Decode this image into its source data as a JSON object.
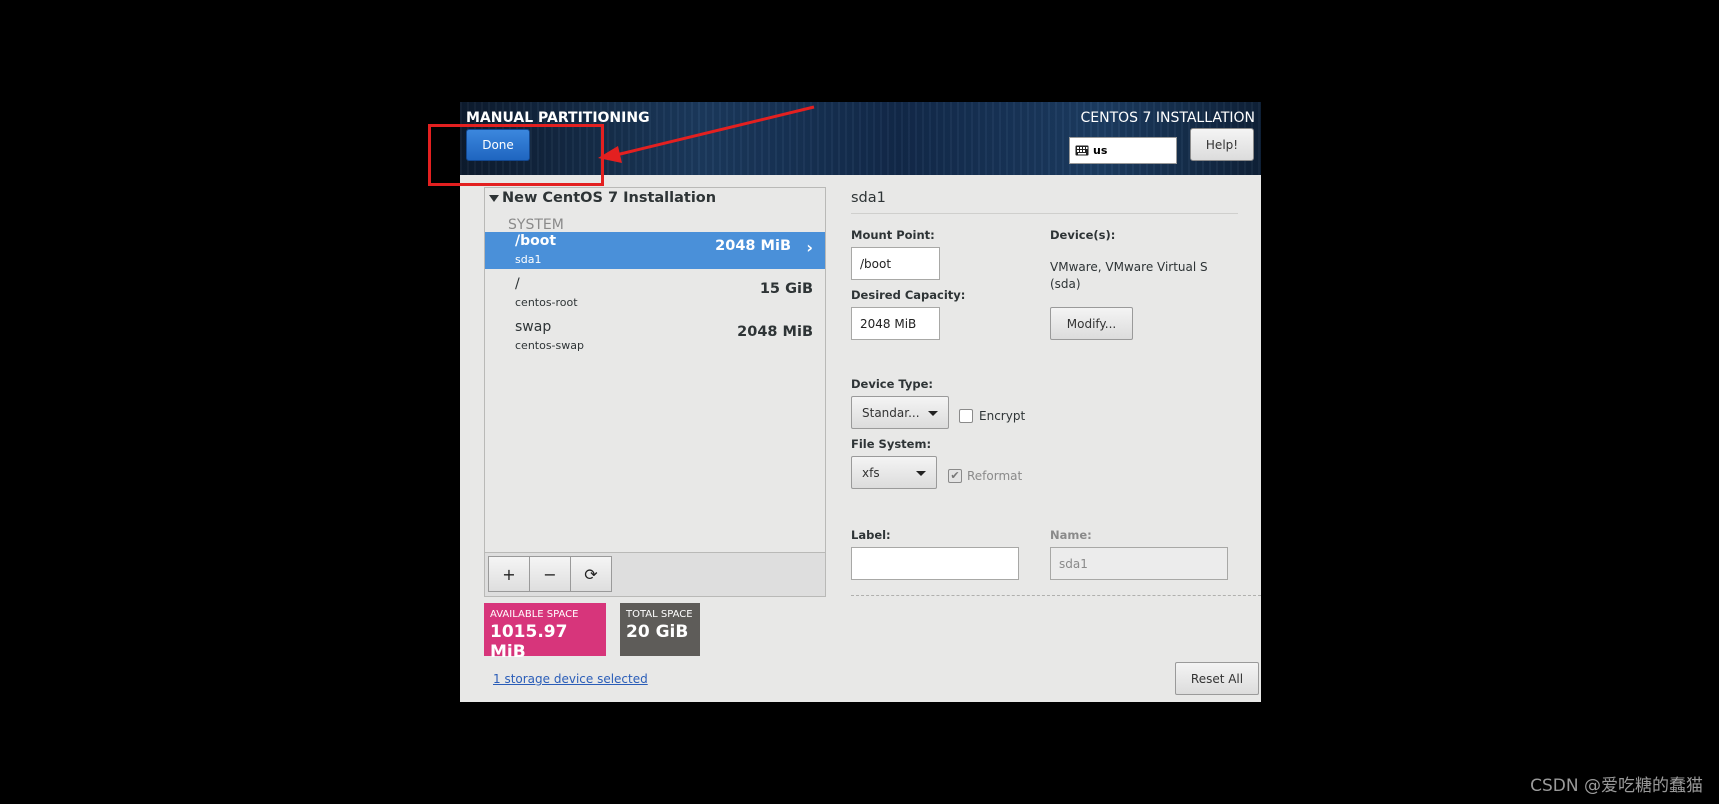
{
  "header": {
    "title": "MANUAL PARTITIONING",
    "product": "CENTOS 7 INSTALLATION",
    "done_label": "Done",
    "keyboard_layout": "us",
    "help_label": "Help!"
  },
  "tree": {
    "group": "New CentOS 7 Installation",
    "section": "SYSTEM",
    "partitions": [
      {
        "mount": "/boot",
        "device": "sda1",
        "size": "2048 MiB",
        "selected": true
      },
      {
        "mount": "/",
        "device": "centos-root",
        "size": "15 GiB",
        "selected": false
      },
      {
        "mount": "swap",
        "device": "centos-swap",
        "size": "2048 MiB",
        "selected": false
      }
    ]
  },
  "toolbar": {
    "add": "+",
    "remove": "−",
    "refresh": "⟳"
  },
  "space": {
    "available_label": "AVAILABLE SPACE",
    "available_value": "1015.97 MiB",
    "total_label": "TOTAL SPACE",
    "total_value": "20 GiB"
  },
  "storage_link": "1 storage device selected",
  "detail": {
    "title": "sda1",
    "mount_point_label": "Mount Point:",
    "mount_point_value": "/boot",
    "desired_capacity_label": "Desired Capacity:",
    "desired_capacity_value": "2048 MiB",
    "devices_label": "Device(s):",
    "devices_value_line1": "VMware, VMware Virtual S",
    "devices_value_line2": "(sda)",
    "modify_label": "Modify...",
    "device_type_label": "Device Type:",
    "device_type_value": "Standar...",
    "encrypt_label": "Encrypt",
    "encrypt_checked": false,
    "file_system_label": "File System:",
    "file_system_value": "xfs",
    "reformat_label": "Reformat",
    "reformat_checked": true,
    "label_label": "Label:",
    "label_value": "",
    "name_label": "Name:",
    "name_value": "sda1",
    "reset_all_label": "Reset All"
  },
  "watermark": "CSDN @爱吃糖的蠢猫",
  "colors": {
    "selected_row": "#4a90d9",
    "available_space": "#d7357b",
    "total_space": "#5e5c59",
    "done_button": "#2a74d0",
    "annotation": "#e32020"
  }
}
